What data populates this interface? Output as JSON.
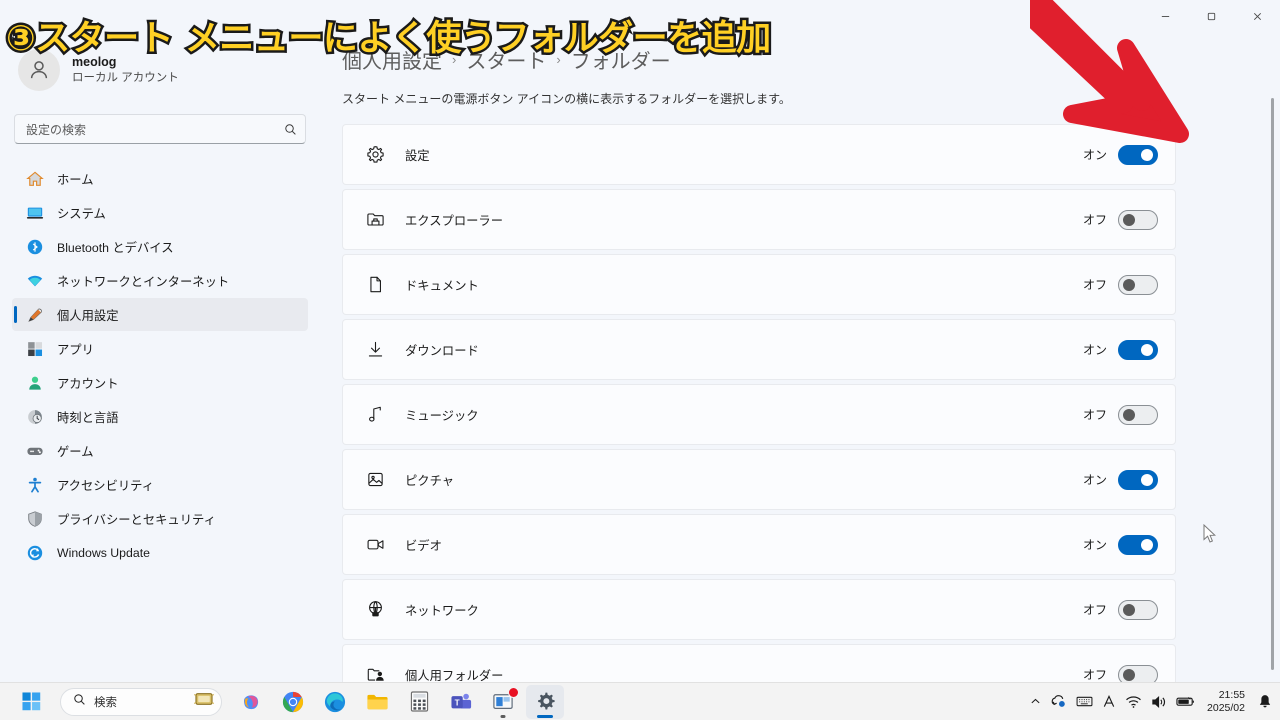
{
  "window": {
    "controls": [
      {
        "name": "minimize",
        "glyph": "minimize-icon"
      },
      {
        "name": "maximize",
        "glyph": "maximize-icon"
      },
      {
        "name": "close",
        "glyph": "close-icon"
      }
    ]
  },
  "sidebar": {
    "profile": {
      "name": "meolog",
      "subtitle": "ローカル アカウント",
      "avatar": "user-avatar-icon"
    },
    "search": {
      "placeholder": "設定の検索",
      "icon": "search-icon"
    },
    "items": [
      {
        "label": "ホーム",
        "icon": "home-icon",
        "active": false
      },
      {
        "label": "システム",
        "icon": "system-icon",
        "active": false
      },
      {
        "label": "Bluetooth とデバイス",
        "icon": "bluetooth-icon",
        "active": false
      },
      {
        "label": "ネットワークとインターネット",
        "icon": "network-icon",
        "active": false
      },
      {
        "label": "個人用設定",
        "icon": "personalization-icon",
        "active": true
      },
      {
        "label": "アプリ",
        "icon": "apps-icon",
        "active": false
      },
      {
        "label": "アカウント",
        "icon": "accounts-icon",
        "active": false
      },
      {
        "label": "時刻と言語",
        "icon": "time-language-icon",
        "active": false
      },
      {
        "label": "ゲーム",
        "icon": "gaming-icon",
        "active": false
      },
      {
        "label": "アクセシビリティ",
        "icon": "accessibility-icon",
        "active": false
      },
      {
        "label": "プライバシーとセキュリティ",
        "icon": "privacy-security-icon",
        "active": false
      },
      {
        "label": "Windows Update",
        "icon": "windows-update-icon",
        "active": false
      }
    ]
  },
  "main": {
    "breadcrumb": [
      "個人用設定",
      "スタート",
      "フォルダー"
    ],
    "breadcrumb_separator": "›",
    "description": "スタート メニューの電源ボタン アイコンの横に表示するフォルダーを選択します。",
    "folders": [
      {
        "label": "設定",
        "icon": "gear-icon",
        "state": "オン",
        "on": true
      },
      {
        "label": "エクスプローラー",
        "icon": "file-explorer-icon",
        "state": "オフ",
        "on": false
      },
      {
        "label": "ドキュメント",
        "icon": "document-icon",
        "state": "オフ",
        "on": false
      },
      {
        "label": "ダウンロード",
        "icon": "download-icon",
        "state": "オン",
        "on": true
      },
      {
        "label": "ミュージック",
        "icon": "music-note-icon",
        "state": "オフ",
        "on": false
      },
      {
        "label": "ピクチャ",
        "icon": "picture-icon",
        "state": "オン",
        "on": true
      },
      {
        "label": "ビデオ",
        "icon": "video-camera-icon",
        "state": "オン",
        "on": true
      },
      {
        "label": "ネットワーク",
        "icon": "network-globe-icon",
        "state": "オフ",
        "on": false
      },
      {
        "label": "個人用フォルダー",
        "icon": "personal-folder-icon",
        "state": "オフ",
        "on": false
      }
    ]
  },
  "annotation": {
    "text": "③スタート メニューによく使うフォルダーを追加",
    "text_color": "#ffd024",
    "outline_color": "#1a1a1a",
    "arrow_color": "#e01f2d",
    "arrow": "red-arrow-down-right"
  },
  "taskbar": {
    "start": {
      "name": "start-button",
      "icon": "windows-logo-icon"
    },
    "search": {
      "label": "検索",
      "icon": "search-icon",
      "right_icon": "ime-pad-icon"
    },
    "apps": [
      {
        "name": "copilot",
        "icon": "copilot-icon"
      },
      {
        "name": "chrome",
        "icon": "chrome-icon"
      },
      {
        "name": "edge",
        "icon": "edge-icon"
      },
      {
        "name": "file-explorer",
        "icon": "folder-icon"
      },
      {
        "name": "calculator",
        "icon": "calculator-icon"
      },
      {
        "name": "teams",
        "icon": "teams-icon"
      },
      {
        "name": "store",
        "icon": "microsoft-store-icon",
        "badge": true,
        "running": true
      },
      {
        "name": "settings",
        "icon": "settings-gear-icon",
        "selected": true
      }
    ],
    "tray": {
      "chevron": "chevron-up-icon",
      "icons": [
        "onedrive-sync-icon",
        "keyboard-ime-icon",
        "ime-mode-a-icon",
        "wifi-icon",
        "volume-icon",
        "battery-icon"
      ],
      "time": "21:55",
      "date": "2025/02",
      "notification": "bell-icon"
    }
  }
}
